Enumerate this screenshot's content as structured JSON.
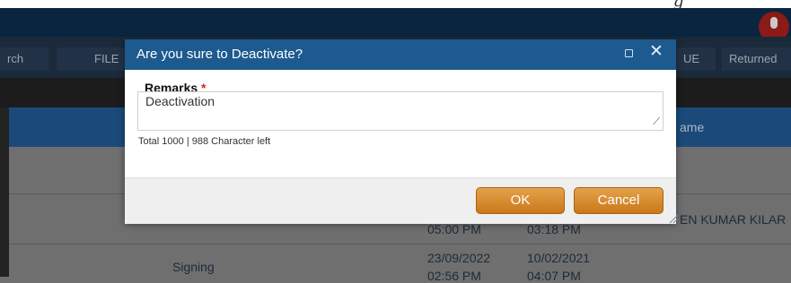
{
  "toolbar": {
    "buttons": [
      "rch",
      "FILE",
      "UE",
      "Returned"
    ]
  },
  "table": {
    "header_name": "ame",
    "rows": [
      {
        "status": "",
        "date1": "05:00 PM",
        "date2": "03:18 PM",
        "name": "EN KUMAR KILAR"
      },
      {
        "status": "Signing",
        "date1": "23/09/2022",
        "date2": "10/02/2021",
        "time1": "02:56 PM",
        "time2": "04:07 PM"
      }
    ]
  },
  "dialog": {
    "title": "Are you sure to Deactivate?",
    "remarks_label": "Remarks",
    "required_mark": "*",
    "remarks_value": "Deactivation",
    "counter": "Total 1000 | 988 Character left",
    "ok_label": "OK",
    "cancel_label": "Cancel"
  },
  "colors": {
    "dialog_header": "#1d5a8f",
    "button": "#d98a2b",
    "table_header": "#1b4a7a"
  },
  "icons": [
    "microphone-icon",
    "maximize-icon",
    "close-icon",
    "resize-grip-icon"
  ]
}
